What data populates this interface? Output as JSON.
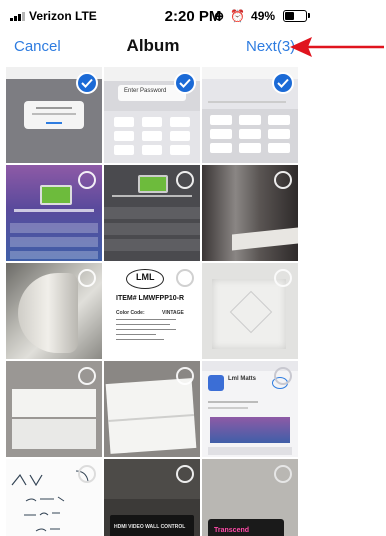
{
  "status_bar": {
    "carrier": "Verizon LTE",
    "time": "2:20 PM",
    "battery_percent": "49%",
    "battery_level": 0.49,
    "signal_bars": 3,
    "signal_total": 4
  },
  "nav": {
    "cancel_label": "Cancel",
    "title": "Album",
    "next_label": "Next(3)",
    "accent_color": "#2e7ce0"
  },
  "annotation": {
    "arrow_color": "#e0141e"
  },
  "selection": {
    "check_color": "#1b6ad6",
    "selected_count": 3
  },
  "photos": {
    "r1c2_title": "Enter Password",
    "r3c2_logo": "LML",
    "r3c2_item": "ITEM# LMWFPP10-R",
    "r3c2_color_code": "Color Code:",
    "r3c2_color_value": "VINTAGE",
    "r4c3_title": "Lml Matts",
    "r5c2_brand": "HDMI VIDEO WALL CONTROL",
    "r5c3_brand": "Transcend"
  }
}
